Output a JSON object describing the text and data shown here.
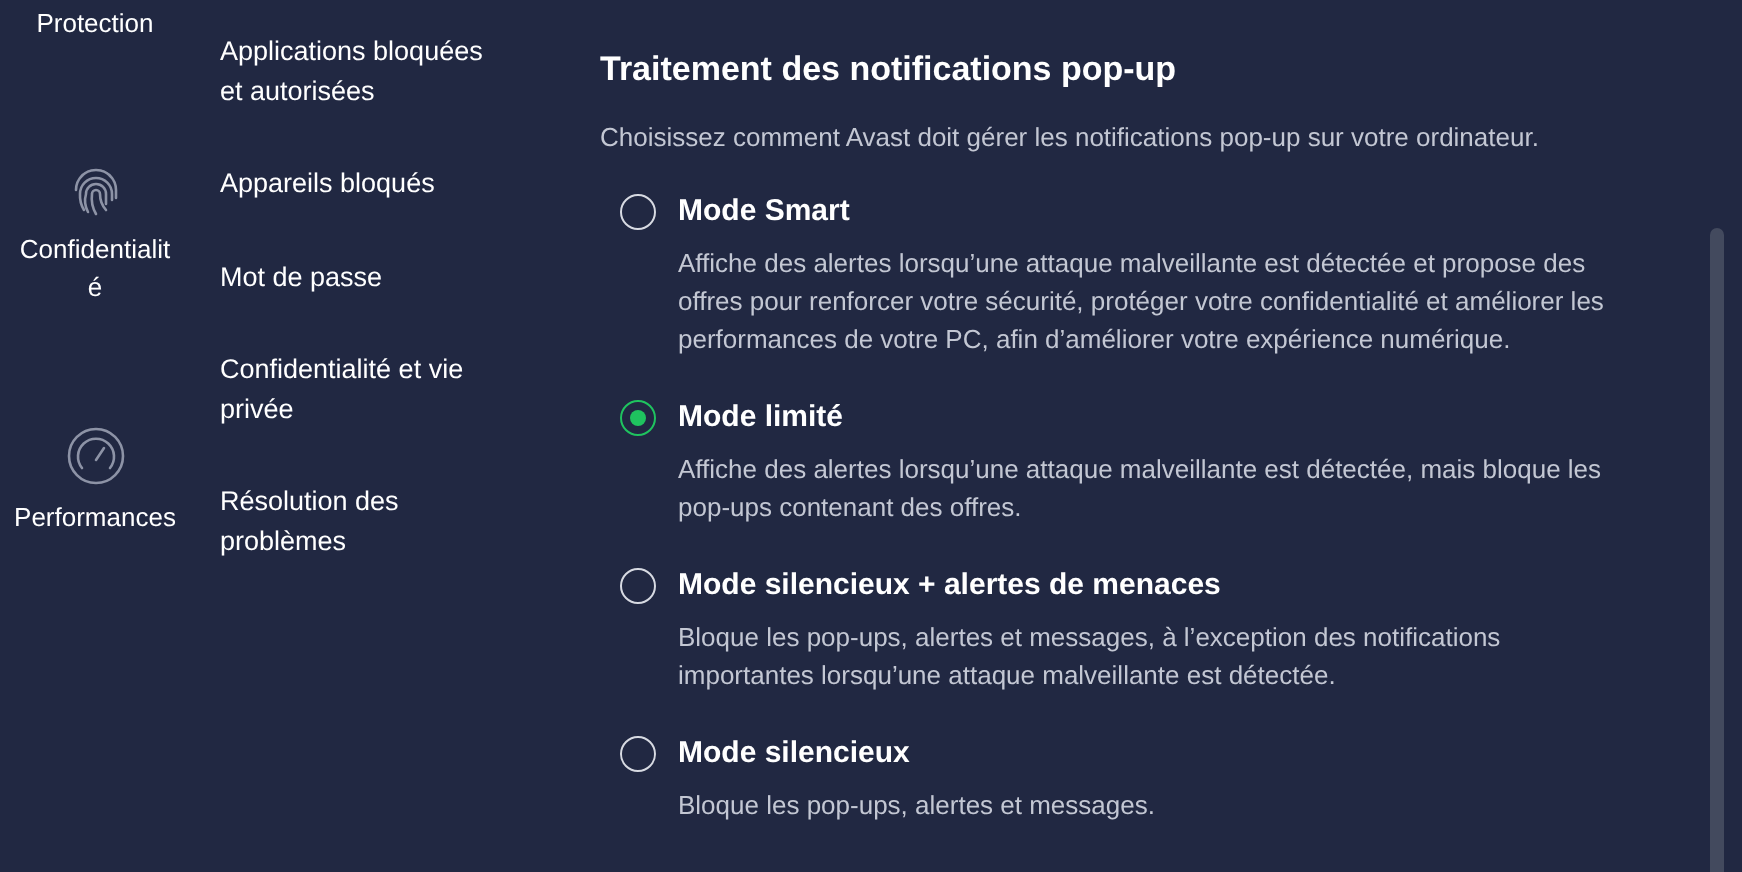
{
  "rail": [
    {
      "label": "Protection"
    },
    {
      "label": "Confidentialité"
    },
    {
      "label": "Performances"
    }
  ],
  "nav": [
    "Applications bloquées et autorisées",
    "Appareils bloqués",
    "Mot de passe",
    "Confidentialité et vie privée",
    "Résolution des problèmes"
  ],
  "section": {
    "title": "Traitement des notifications pop-up",
    "subtitle": "Choisissez comment Avast doit gérer les notifications pop-up sur votre ordinateur.",
    "options": [
      {
        "label": "Mode Smart",
        "selected": false,
        "description": "Affiche des alertes lorsqu’une attaque malveillante est détectée et propose des offres pour renforcer votre sécurité, protéger votre confidentialité et améliorer les performances de votre PC, afin d’améliorer votre expérience numérique."
      },
      {
        "label": "Mode limité",
        "selected": true,
        "description": "Affiche des alertes lorsqu’une attaque malveillante est détectée, mais bloque les pop-ups contenant des offres."
      },
      {
        "label": "Mode silencieux + alertes de menaces",
        "selected": false,
        "description": "Bloque les pop-ups, alertes et messages, à l’exception des notifications importantes lorsqu’une attaque malveillante est détectée."
      },
      {
        "label": "Mode silencieux",
        "selected": false,
        "description": "Bloque les pop-ups, alertes et messages."
      }
    ]
  }
}
